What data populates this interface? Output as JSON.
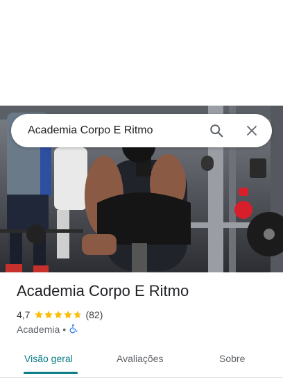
{
  "search": {
    "query": "Academia Corpo E Ritmo"
  },
  "icons": {
    "search": "search-icon",
    "close": "close-icon",
    "accessibility": "wheelchair-icon",
    "star": "star-icon"
  },
  "place": {
    "name": "Academia Corpo E Ritmo",
    "rating": "4,7",
    "rating_value": 4.7,
    "review_count": "(82)",
    "category": "Academia",
    "separator": "•"
  },
  "tabs": [
    {
      "label": "Visão geral",
      "active": true
    },
    {
      "label": "Avaliações",
      "active": false
    },
    {
      "label": "Sobre",
      "active": false
    }
  ],
  "colors": {
    "accent": "#0b7c86",
    "star": "#fbbc04",
    "accessibility": "#1a73e8"
  }
}
